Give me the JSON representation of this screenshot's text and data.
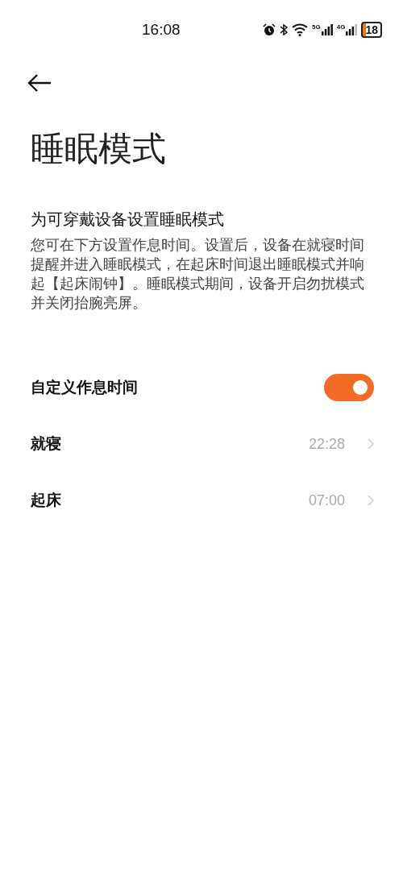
{
  "status_bar": {
    "time": "16:08",
    "network_labels": [
      "5G",
      "4G"
    ],
    "battery": "18"
  },
  "page": {
    "title": "睡眠模式"
  },
  "intro": {
    "heading": "为可穿戴设备设置睡眠模式",
    "body": "您可在下方设置作息时间。设置后，设备在就寝时间提醒并进入睡眠模式，在起床时间退出睡眠模式并响起【起床闹钟】。睡眠模式期间，设备开启勿扰模式并关闭抬腕亮屏。"
  },
  "settings": [
    {
      "kind": "switch",
      "label": "自定义作息时间",
      "on": true
    },
    {
      "kind": "time",
      "label": "就寝",
      "value": "22:28"
    },
    {
      "kind": "time",
      "label": "起床",
      "value": "07:00"
    }
  ]
}
